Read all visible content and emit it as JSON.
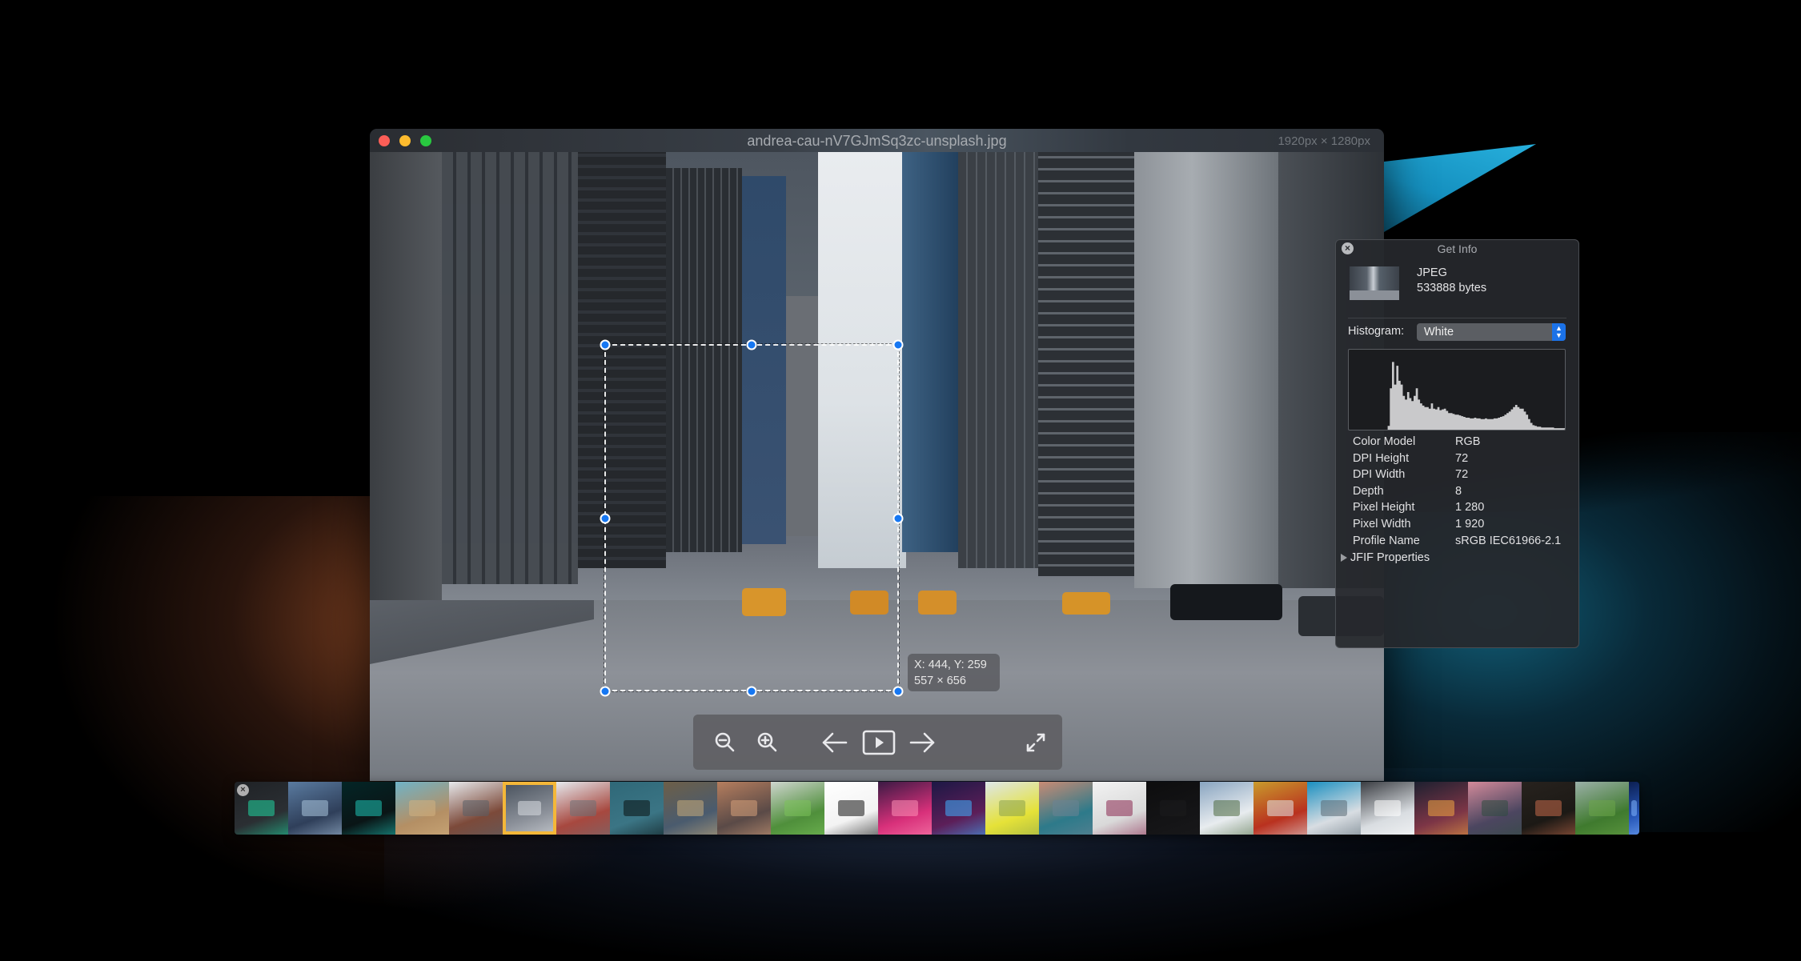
{
  "window": {
    "title": "andrea-cau-nV7GJmSq3zc-unsplash.jpg",
    "dimensions": "1920px × 1280px",
    "traffic_lights": [
      "close",
      "minimize",
      "maximize"
    ]
  },
  "selection": {
    "position_label": "X: 444, Y: 259",
    "size_label": "557 × 656"
  },
  "toolbar": {
    "buttons": [
      {
        "name": "zoom-out",
        "icon": "zoom-out-icon"
      },
      {
        "name": "zoom-in",
        "icon": "zoom-in-icon"
      },
      {
        "name": "previous",
        "icon": "arrow-left-icon"
      },
      {
        "name": "slideshow",
        "icon": "play-icon"
      },
      {
        "name": "next",
        "icon": "arrow-right-icon"
      },
      {
        "name": "fullscreen",
        "icon": "expand-icon"
      }
    ]
  },
  "info_panel": {
    "title": "Get Info",
    "close_icon": "×",
    "file_type": "JPEG",
    "file_size": "533888 bytes",
    "histogram_label": "Histogram:",
    "histogram_channel": "White",
    "histogram_select_icon": "⌃⌄",
    "properties": [
      {
        "key": "Color Model",
        "value": "RGB"
      },
      {
        "key": "DPI Height",
        "value": "72"
      },
      {
        "key": "DPI Width",
        "value": "72"
      },
      {
        "key": "Depth",
        "value": "8"
      },
      {
        "key": "Pixel Height",
        "value": "1 280"
      },
      {
        "key": "Pixel Width",
        "value": "1 920"
      },
      {
        "key": "Profile Name",
        "value": "sRGB IEC61966-2.1"
      }
    ],
    "jfif_label": "JFIF Properties",
    "histogram_profile": [
      0,
      0,
      0,
      0,
      0,
      0,
      0,
      0,
      0,
      0,
      0,
      0,
      0,
      0,
      0,
      0,
      0,
      0,
      0.05,
      0.55,
      0.9,
      0.6,
      0.85,
      0.65,
      0.6,
      0.45,
      0.4,
      0.5,
      0.42,
      0.38,
      0.45,
      0.55,
      0.4,
      0.35,
      0.32,
      0.3,
      0.3,
      0.28,
      0.35,
      0.28,
      0.27,
      0.3,
      0.26,
      0.27,
      0.28,
      0.25,
      0.22,
      0.22,
      0.21,
      0.2,
      0.2,
      0.19,
      0.18,
      0.17,
      0.16,
      0.16,
      0.15,
      0.15,
      0.16,
      0.15,
      0.15,
      0.14,
      0.14,
      0.15,
      0.14,
      0.14,
      0.14,
      0.15,
      0.15,
      0.16,
      0.17,
      0.18,
      0.2,
      0.22,
      0.24,
      0.27,
      0.3,
      0.33,
      0.3,
      0.28,
      0.28,
      0.24,
      0.2,
      0.14,
      0.09,
      0.06,
      0.05,
      0.04,
      0.04,
      0.03,
      0.03,
      0.03,
      0.03,
      0.03,
      0.03,
      0.02,
      0.02,
      0.02,
      0.02,
      0.02
    ],
    "selected_file_close": "×"
  },
  "filmstrip": {
    "selected_index": 5,
    "thumbnails": [
      {
        "label": "green-zigzag",
        "c1": "#1f2226",
        "c2": "#2b2f33",
        "accent": "#1fd6a0"
      },
      {
        "label": "vessel-building",
        "c1": "#5a7ba0",
        "c2": "#2f3f5a",
        "accent": "#a9c4dd"
      },
      {
        "label": "teal-hexagons",
        "c1": "#032526",
        "c2": "#0a1516",
        "accent": "#1ec2b5"
      },
      {
        "label": "desert-rocks",
        "c1": "#6fb3c7",
        "c2": "#b48f64",
        "accent": "#d2b07f"
      },
      {
        "label": "manhattan-bridge",
        "c1": "#e7e9ec",
        "c2": "#7c4a3a",
        "accent": "#5a5f66"
      },
      {
        "label": "city-street",
        "c1": "#4c5560",
        "c2": "#8b9099",
        "accent": "#d9dde1"
      },
      {
        "label": "colorful-houses",
        "c1": "#e5e9ee",
        "c2": "#a7483f",
        "accent": "#6c6f75"
      },
      {
        "label": "mountain-lake",
        "c1": "#2f6878",
        "c2": "#3b7585",
        "accent": "#0a1010"
      },
      {
        "label": "abstract-swirl",
        "c1": "#6d5f48",
        "c2": "#4a5b6e",
        "accent": "#c7ab7b"
      },
      {
        "label": "city-skyline",
        "c1": "#b67e5e",
        "c2": "#5a4a47",
        "accent": "#d6a07a"
      },
      {
        "label": "green-building",
        "c1": "#cfd5cf",
        "c2": "#4f8f3b",
        "accent": "#7bc35a"
      },
      {
        "label": "black-lines",
        "c1": "#ffffff",
        "c2": "#f3f3f3",
        "accent": "#111111"
      },
      {
        "label": "pink-corridor",
        "c1": "#3b1a44",
        "c2": "#d8307a",
        "accent": "#ff8fb6"
      },
      {
        "label": "neon-lights",
        "c1": "#1c1845",
        "c2": "#5c1e58",
        "accent": "#3fb1ff"
      },
      {
        "label": "yellow-field",
        "c1": "#dde6ea",
        "c2": "#e5e238",
        "accent": "#8aa34a"
      },
      {
        "label": "moraine-lake",
        "c1": "#c98b74",
        "c2": "#2d7a8a",
        "accent": "#6a8393"
      },
      {
        "label": "phone-laptop",
        "c1": "#f2f2f2",
        "c2": "#d9d9d9",
        "accent": "#8a2850"
      },
      {
        "label": "dark",
        "c1": "#0d0d0e",
        "c2": "#141416",
        "accent": "#1b1b1d"
      },
      {
        "label": "snow-mountain",
        "c1": "#88a4c0",
        "c2": "#e8ecef",
        "accent": "#4c6a3f"
      },
      {
        "label": "autumn-tree",
        "c1": "#c99b2c",
        "c2": "#b9311f",
        "accent": "#e2e6ea"
      },
      {
        "label": "blue-building",
        "c1": "#1a8fc0",
        "c2": "#d8dde2",
        "accent": "#5a6a75"
      },
      {
        "label": "white-star",
        "c1": "#3a3d42",
        "c2": "#d9dde1",
        "accent": "#ffffff"
      },
      {
        "label": "tokyo-night",
        "c1": "#1d2030",
        "c2": "#7c3546",
        "accent": "#f0a542"
      },
      {
        "label": "pink-mountains",
        "c1": "#d38a9a",
        "c2": "#4c4660",
        "accent": "#2f4d3f"
      },
      {
        "label": "copper-sphere",
        "c1": "#27221e",
        "c2": "#1c1915",
        "accent": "#c46a4a"
      },
      {
        "label": "green-hills",
        "c1": "#9bb0a8",
        "c2": "#3f7a2e",
        "accent": "#6ca548"
      },
      {
        "label": "blue-lights",
        "c1": "#0c1f52",
        "c2": "#2757b9",
        "accent": "#7fb4ff"
      }
    ]
  }
}
